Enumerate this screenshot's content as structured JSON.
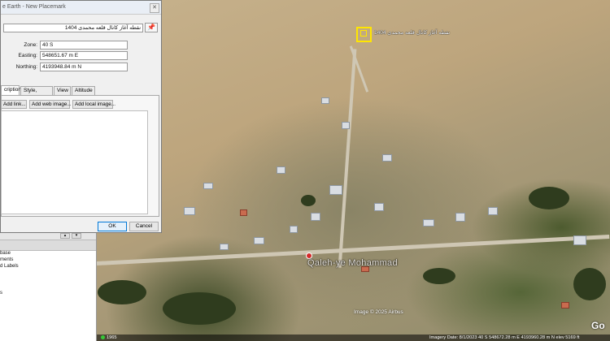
{
  "dialog": {
    "title": "e Earth - New Placemark",
    "name_value": "نقطه آغاز کانال قلعه محمدی 1404",
    "pin_icon": "pushpin-icon",
    "zone_label": "Zone:",
    "zone_value": "40 S",
    "easting_label": "Easting:",
    "easting_value": "548651.67 m E",
    "northing_label": "Northing:",
    "northing_value": "4193948.84 m N",
    "tabs": [
      "cription",
      "Style, Color",
      "View",
      "Altitude"
    ],
    "add_link": "Add link...",
    "add_web_image": "Add web image...",
    "add_local_image": "Add local image...",
    "ok": "OK",
    "cancel": "Cancel"
  },
  "sidebar": {
    "layers": [
      "base",
      "ments",
      "d Labels",
      "s"
    ]
  },
  "map": {
    "placemark_label": "نقطه آغاز کانال قلعه محمدی 1404",
    "place_name": "Qaleh-ye Mohammad",
    "imagery_credit": "Image © 2025 Airbus",
    "logo": "Go",
    "status": "Imagery Date: 8/1/2023   40 S 548672.28 m E 4193960.28 m N  elev 5169 ft",
    "scale_text": "1965",
    "colors": {
      "placemark": "#ffe600",
      "pin": "#d42a2a"
    }
  }
}
